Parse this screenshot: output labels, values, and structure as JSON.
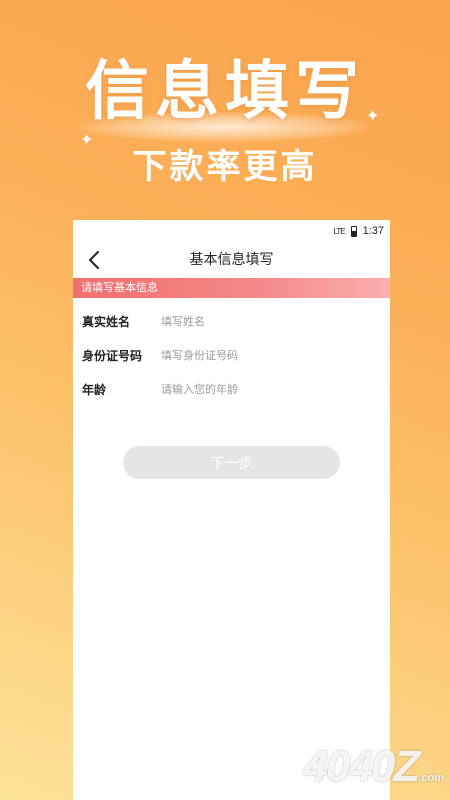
{
  "promo": {
    "title": "信息填写",
    "subtitle": "下款率更高"
  },
  "status_bar": {
    "signal": "LTE",
    "time": "1:37"
  },
  "nav": {
    "title": "基本信息填写"
  },
  "section": {
    "banner": "请填写基本信息"
  },
  "form": {
    "fields": [
      {
        "label": "真实姓名",
        "placeholder": "填写姓名",
        "value": ""
      },
      {
        "label": "身份证号码",
        "placeholder": "填写身份证号码",
        "value": ""
      },
      {
        "label": "年龄",
        "placeholder": "请输入您的年龄",
        "value": ""
      }
    ],
    "next_label": "下一步"
  },
  "watermark": {
    "text": "4040Z",
    "suffix": ".com"
  },
  "colors": {
    "background_top": "#fba34d",
    "background_bottom": "#fde39a",
    "banner": "#f16e6e",
    "button_disabled": "#e5e5e5"
  }
}
